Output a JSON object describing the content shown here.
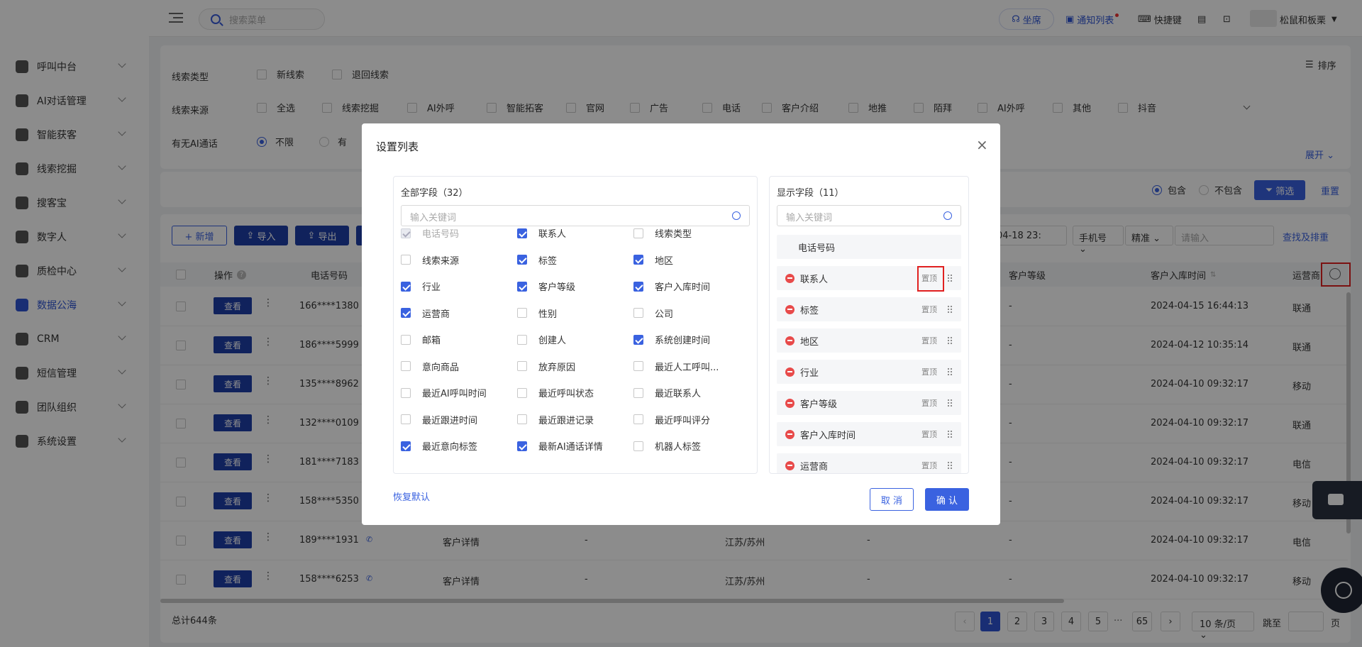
{
  "search": {
    "placeholder": "搜索菜单"
  },
  "topbar": {
    "seat": "坐席",
    "notice": "通知列表",
    "shortcut": "快捷键",
    "user": "松鼠和板栗"
  },
  "sidebar": {
    "items": [
      {
        "label": "呼叫中台"
      },
      {
        "label": "AI对话管理"
      },
      {
        "label": "智能获客"
      },
      {
        "label": "线索挖掘"
      },
      {
        "label": "搜客宝"
      },
      {
        "label": "数字人"
      },
      {
        "label": "质检中心"
      },
      {
        "label": "数据公海"
      },
      {
        "label": "CRM"
      },
      {
        "label": "短信管理"
      },
      {
        "label": "团队组织"
      },
      {
        "label": "系统设置"
      }
    ]
  },
  "filters": {
    "sort": "排序",
    "type_label": "线索类型",
    "type_opts": [
      "新线索",
      "退回线索"
    ],
    "source_label": "线索来源",
    "source_opts": [
      "全选",
      "线索挖掘",
      "AI外呼",
      "智能拓客",
      "官网",
      "广告",
      "电话",
      "客户介绍",
      "地推",
      "陌拜",
      "AI外呼",
      "其他",
      "抖音"
    ],
    "ai_label": "有无AI通话",
    "ai_opts": [
      "不限",
      "有"
    ],
    "expand": "展开",
    "include": "包含",
    "exclude": "不包含",
    "filter_btn": "筛选",
    "reset": "重置"
  },
  "toolbar": {
    "add": "+ 新增",
    "import": "导入",
    "export": "导出",
    "date_value": "04-18 23:",
    "phone_select": "手机号",
    "match_select": "精准",
    "input_placeholder": "请输入",
    "dedupe": "查找及排重"
  },
  "table": {
    "headers": {
      "op": "操作",
      "phone": "电话号码",
      "level": "客户等级",
      "intime": "客户入库时间",
      "carrier": "运营商"
    },
    "view": "查看",
    "rows": [
      {
        "phone": "166****1380",
        "level": "-",
        "time": "2024-04-15 16:44:13",
        "carrier": "联通"
      },
      {
        "phone": "186****5999",
        "level": "-",
        "time": "2024-04-12 10:35:14",
        "carrier": "联通"
      },
      {
        "phone": "135****8962",
        "level": "-",
        "time": "2024-04-10 09:32:17",
        "carrier": "移动"
      },
      {
        "phone": "132****0109",
        "level": "-",
        "time": "2024-04-10 09:32:17",
        "carrier": "联通"
      },
      {
        "phone": "181****7183",
        "level": "-",
        "time": "2024-04-10 09:32:17",
        "carrier": "电信"
      },
      {
        "phone": "158****5350",
        "level": "-",
        "time": "2024-04-10 09:32:17",
        "carrier": "移动"
      },
      {
        "phone": "189****1931",
        "detail": "客户详情",
        "dash": "-",
        "region": "江苏/苏州",
        "dash2": "-",
        "level": "-",
        "time": "2024-04-10 09:32:17",
        "carrier": "电信"
      },
      {
        "phone": "158****6253",
        "detail": "客户详情",
        "dash": "-",
        "region": "江苏/苏州",
        "dash2": "-",
        "level": "-",
        "time": "2024-04-10 09:32:17",
        "carrier": "移动"
      }
    ]
  },
  "footer": {
    "total": "总计644条",
    "pages": [
      "1",
      "2",
      "3",
      "4",
      "5"
    ],
    "ellipsis": "···",
    "last": "65",
    "per_page": "10 条/页",
    "jump": "跳至",
    "page_unit": "页"
  },
  "modal": {
    "title": "设置列表",
    "all_title": "全部字段（32）",
    "all_placeholder": "输入关键词",
    "shown_title": "显示字段（11）",
    "shown_placeholder": "输入关键词",
    "fields": [
      {
        "label": "电话号码",
        "state": "disabled"
      },
      {
        "label": "联系人",
        "state": "on"
      },
      {
        "label": "线索类型",
        "state": "off"
      },
      {
        "label": "线索来源",
        "state": "off"
      },
      {
        "label": "标签",
        "state": "on"
      },
      {
        "label": "地区",
        "state": "on"
      },
      {
        "label": "行业",
        "state": "on"
      },
      {
        "label": "客户等级",
        "state": "on"
      },
      {
        "label": "客户入库时间",
        "state": "on"
      },
      {
        "label": "运营商",
        "state": "on"
      },
      {
        "label": "性别",
        "state": "off"
      },
      {
        "label": "公司",
        "state": "off"
      },
      {
        "label": "邮箱",
        "state": "off"
      },
      {
        "label": "创建人",
        "state": "off"
      },
      {
        "label": "系统创建时间",
        "state": "on"
      },
      {
        "label": "意向商品",
        "state": "off"
      },
      {
        "label": "放弃原因",
        "state": "off"
      },
      {
        "label": "最近人工呼叫...",
        "state": "off"
      },
      {
        "label": "最近AI呼叫时间",
        "state": "off"
      },
      {
        "label": "最近呼叫状态",
        "state": "off"
      },
      {
        "label": "最近联系人",
        "state": "off"
      },
      {
        "label": "最近跟进时间",
        "state": "off"
      },
      {
        "label": "最近跟进记录",
        "state": "off"
      },
      {
        "label": "最近呼叫评分",
        "state": "off"
      },
      {
        "label": "最近意向标签",
        "state": "on"
      },
      {
        "label": "最新AI通话详情",
        "state": "on"
      },
      {
        "label": "机器人标签",
        "state": "off"
      }
    ],
    "fixed_field": "电话号码",
    "shown": [
      {
        "label": "联系人",
        "pin": "置顶"
      },
      {
        "label": "标签",
        "pin": "置顶"
      },
      {
        "label": "地区",
        "pin": "置顶"
      },
      {
        "label": "行业",
        "pin": "置顶"
      },
      {
        "label": "客户等级",
        "pin": "置顶"
      },
      {
        "label": "客户入库时间",
        "pin": "置顶"
      },
      {
        "label": "运营商",
        "pin": "置顶"
      }
    ],
    "restore": "恢复默认",
    "cancel": "取 消",
    "confirm": "确 认"
  }
}
